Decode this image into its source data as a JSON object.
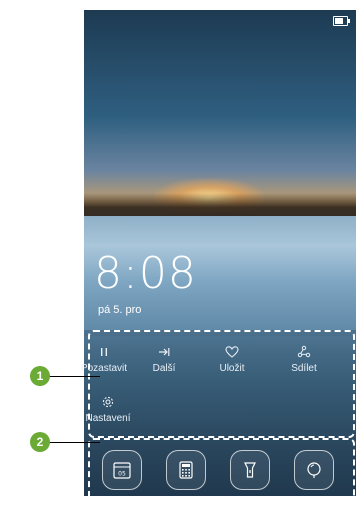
{
  "lockscreen": {
    "time": "8:08",
    "date": "pá 5. pro",
    "battery_fraction": 0.7
  },
  "magazine_shortcuts": [
    {
      "label": "Pozastavit",
      "icon": "pause-icon"
    },
    {
      "label": "Další",
      "icon": "next-icon"
    },
    {
      "label": "Uložit",
      "icon": "heart-icon"
    },
    {
      "label": "Sdílet",
      "icon": "share-icon"
    },
    {
      "label": "Nastavení",
      "icon": "settings-gear-icon"
    }
  ],
  "dock_apps": [
    {
      "label": "05",
      "icon": "calendar-icon"
    },
    {
      "icon": "calculator-icon"
    },
    {
      "icon": "flashlight-icon"
    },
    {
      "icon": "recorder-icon"
    }
  ],
  "callouts": [
    "1",
    "2"
  ],
  "colors": {
    "callout_green": "#6aaa35",
    "highlight": "#ffffff"
  }
}
